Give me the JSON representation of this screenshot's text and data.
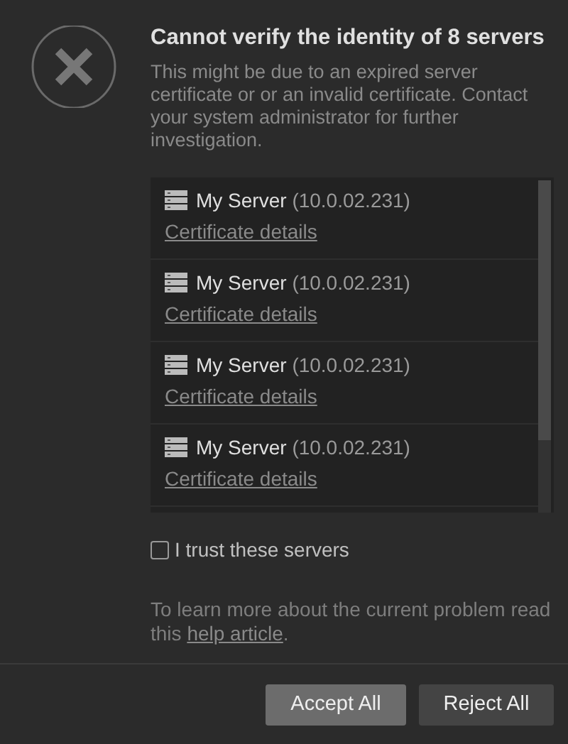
{
  "title": "Cannot verify the identity of 8 servers",
  "message": "This might be due to an expired server certificate or or an invalid certificate. Contact your system administrator for further investigation.",
  "servers": [
    {
      "name": "My Server",
      "address": "(10.0.02.231)",
      "link": "Certificate details"
    },
    {
      "name": "My Server",
      "address": "(10.0.02.231)",
      "link": "Certificate details"
    },
    {
      "name": "My Server",
      "address": "(10.0.02.231)",
      "link": "Certificate details"
    },
    {
      "name": "My Server",
      "address": "(10.0.02.231)",
      "link": "Certificate details"
    }
  ],
  "trust": {
    "label": "I trust these servers",
    "checked": false
  },
  "help": {
    "before": "To learn more about the current problem read this ",
    "link": "help article",
    "after": "."
  },
  "buttons": [
    {
      "label": "Accept All",
      "kind": "primary"
    },
    {
      "label": "Reject All",
      "kind": "secondary"
    }
  ]
}
